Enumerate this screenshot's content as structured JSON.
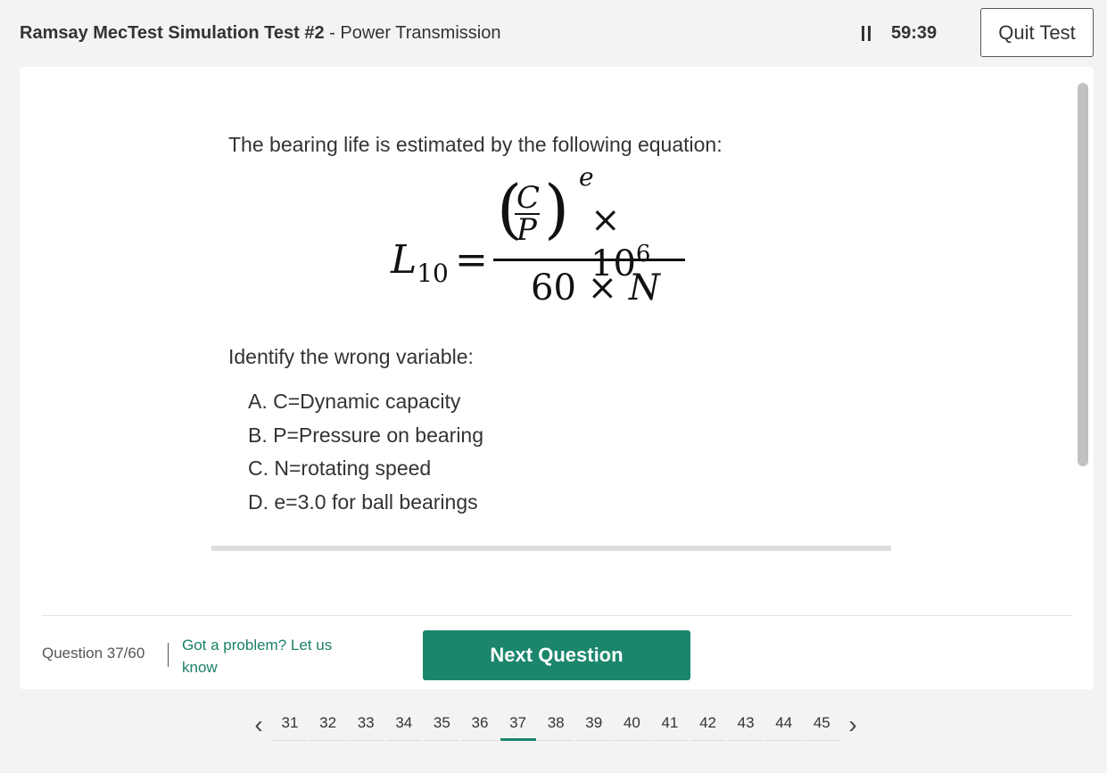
{
  "header": {
    "test_name": "Ramsay MecTest Simulation Test #2",
    "separator": " - ",
    "section": "Power Transmission",
    "timer": "59:39",
    "quit_label": "Quit Test"
  },
  "question": {
    "intro": "The bearing life is estimated by the following equation:",
    "equation": {
      "lhs_symbol": "L",
      "lhs_subscript": "10",
      "equals": "=",
      "ratio_numerator": "C",
      "ratio_denominator": "P",
      "exponent": "e",
      "multiplier": "× 10",
      "multiplier_power": "6",
      "denominator_constant": "60 × ",
      "denominator_variable": "N"
    },
    "prompt": "Identify the wrong variable:",
    "options": [
      {
        "label": "A. C=Dynamic capacity"
      },
      {
        "label": "B. P=Pressure on bearing"
      },
      {
        "label": "C. N=rotating speed"
      },
      {
        "label": "D. e=3.0 for ball bearings"
      }
    ]
  },
  "footer": {
    "question_counter": "Question 37/60",
    "problem_link": "Got a problem? Let us know",
    "next_label": "Next Question"
  },
  "pagination": {
    "pages": [
      "31",
      "32",
      "33",
      "34",
      "35",
      "36",
      "37",
      "38",
      "39",
      "40",
      "41",
      "42",
      "43",
      "44",
      "45"
    ],
    "current": "37",
    "prev_icon": "chevron-left-icon",
    "next_icon": "chevron-right-icon"
  },
  "colors": {
    "accent": "#1b866c",
    "link": "#1a8069",
    "background": "#f3f3f3"
  }
}
